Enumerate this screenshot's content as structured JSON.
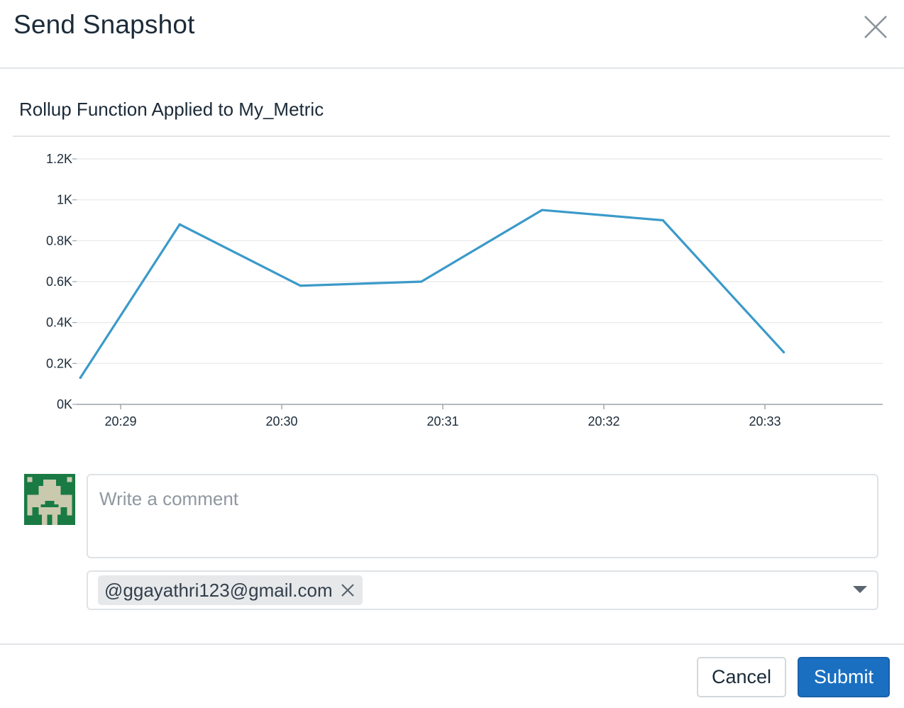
{
  "dialog": {
    "title": "Send Snapshot",
    "close_icon": "close-icon"
  },
  "widget": {
    "title": "Rollup Function Applied to My_Metric"
  },
  "chart_data": {
    "type": "line",
    "title": "Rollup Function Applied to My_Metric",
    "xlabel": "",
    "ylabel": "",
    "x_ticks": [
      "20:29",
      "20:30",
      "20:31",
      "20:32",
      "20:33"
    ],
    "y_ticks": [
      "0K",
      "0.2K",
      "0.4K",
      "0.6K",
      "0.8K",
      "1K",
      "1.2K"
    ],
    "ylim": [
      0,
      1200
    ],
    "grid": true,
    "series": [
      {
        "color": "#3b9ac9",
        "x": [
          "20:28:45",
          "20:29:22",
          "20:30:07",
          "20:30:52",
          "20:31:37",
          "20:32:22",
          "20:33:07"
        ],
        "y": [
          130,
          880,
          580,
          600,
          950,
          900,
          255
        ]
      }
    ]
  },
  "comment": {
    "placeholder": "Write a comment",
    "value": ""
  },
  "recipients": {
    "items": [
      {
        "label": "@ggayathri123@gmail.com"
      }
    ],
    "dropdown_icon": "chevron-down-icon"
  },
  "avatar": {
    "icon": "identicon-avatar",
    "color": "#1a7a44"
  },
  "footer": {
    "cancel_label": "Cancel",
    "submit_label": "Submit"
  },
  "colors": {
    "accent": "#1a6fc1",
    "line": "#3b9ac9"
  }
}
